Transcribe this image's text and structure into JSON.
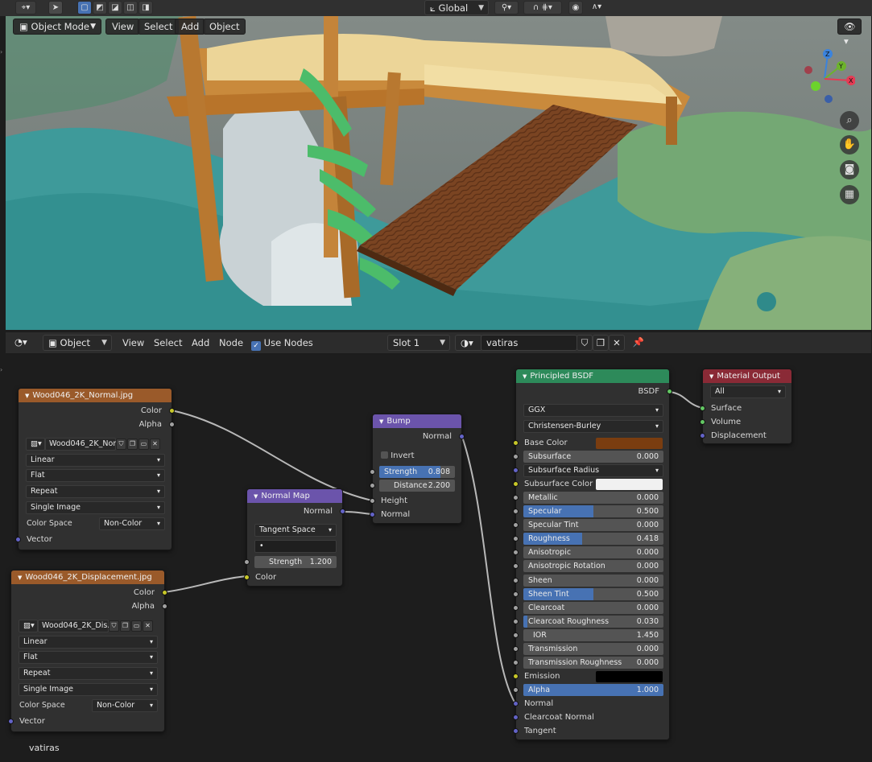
{
  "viewport": {
    "mode": "Object Mode",
    "menus": [
      "View",
      "Select",
      "Add",
      "Object"
    ],
    "orientation": "Global",
    "gizmo_axes": [
      "Z",
      "Y",
      "X"
    ]
  },
  "node_editor": {
    "editor_type": "Object",
    "menus": [
      "View",
      "Select",
      "Add",
      "Node"
    ],
    "use_nodes_label": "Use Nodes",
    "slot": "Slot 1",
    "material": "vatiras",
    "footer_material": "vatiras"
  },
  "nodes": {
    "normal_tex": {
      "title": "Wood046_2K_Normal.jpg",
      "out_color": "Color",
      "out_alpha": "Alpha",
      "image": "Wood046_2K_Nor...",
      "interpolation": "Linear",
      "projection": "Flat",
      "extension": "Repeat",
      "source": "Single Image",
      "color_space_label": "Color Space",
      "color_space": "Non-Color",
      "in_vector": "Vector"
    },
    "disp_tex": {
      "title": "Wood046_2K_Displacement.jpg",
      "out_color": "Color",
      "out_alpha": "Alpha",
      "image": "Wood046_2K_Dis...",
      "interpolation": "Linear",
      "projection": "Flat",
      "extension": "Repeat",
      "source": "Single Image",
      "color_space_label": "Color Space",
      "color_space": "Non-Color",
      "in_vector": "Vector"
    },
    "normal_map": {
      "title": "Normal Map",
      "out_normal": "Normal",
      "space": "Tangent Space",
      "uv": "•",
      "strength_label": "Strength",
      "strength": "1.200",
      "in_color": "Color"
    },
    "bump": {
      "title": "Bump",
      "out_normal": "Normal",
      "invert": "Invert",
      "strength_label": "Strength",
      "strength": "0.808",
      "strength_fraction": 0.808,
      "distance_label": "Distance",
      "distance": "2.200",
      "in_height": "Height",
      "in_normal": "Normal"
    },
    "bsdf": {
      "title": "Principled BSDF",
      "out": "BSDF",
      "distribution": "GGX",
      "subsurface_method": "Christensen-Burley",
      "inputs": [
        {
          "label": "Base Color",
          "type": "color",
          "color": "#7a3d10",
          "sock": "yel"
        },
        {
          "label": "Subsurface",
          "value": "0.000",
          "fraction": 0,
          "sock": "gry"
        },
        {
          "label": "Subsurface Radius",
          "type": "select",
          "sock": "blu"
        },
        {
          "label": "Subsurface Color",
          "type": "color",
          "color": "#f0f0f0",
          "sock": "yel"
        },
        {
          "label": "Metallic",
          "value": "0.000",
          "fraction": 0,
          "sock": "gry"
        },
        {
          "label": "Specular",
          "value": "0.500",
          "fraction": 0.5,
          "sock": "gry"
        },
        {
          "label": "Specular Tint",
          "value": "0.000",
          "fraction": 0,
          "sock": "gry"
        },
        {
          "label": "Roughness",
          "value": "0.418",
          "fraction": 0.418,
          "sock": "gry"
        },
        {
          "label": "Anisotropic",
          "value": "0.000",
          "fraction": 0,
          "sock": "gry"
        },
        {
          "label": "Anisotropic Rotation",
          "value": "0.000",
          "fraction": 0,
          "sock": "gry"
        },
        {
          "label": "Sheen",
          "value": "0.000",
          "fraction": 0,
          "sock": "gry"
        },
        {
          "label": "Sheen Tint",
          "value": "0.500",
          "fraction": 0.5,
          "sock": "gry"
        },
        {
          "label": "Clearcoat",
          "value": "0.000",
          "fraction": 0,
          "sock": "gry"
        },
        {
          "label": "Clearcoat Roughness",
          "value": "0.030",
          "fraction": 0.03,
          "sock": "gry"
        },
        {
          "label": "IOR",
          "value": "1.450",
          "fraction": 0,
          "sock": "gry",
          "indent": true
        },
        {
          "label": "Transmission",
          "value": "0.000",
          "fraction": 0,
          "sock": "gry"
        },
        {
          "label": "Transmission Roughness",
          "value": "0.000",
          "fraction": 0,
          "sock": "gry"
        },
        {
          "label": "Emission",
          "type": "color",
          "color": "#000000",
          "sock": "yel"
        },
        {
          "label": "Alpha",
          "value": "1.000",
          "fraction": 1,
          "sock": "gry"
        },
        {
          "label": "Normal",
          "type": "socket",
          "sock": "blu"
        },
        {
          "label": "Clearcoat Normal",
          "type": "socket",
          "sock": "blu"
        },
        {
          "label": "Tangent",
          "type": "socket",
          "sock": "blu"
        }
      ]
    },
    "output": {
      "title": "Material Output",
      "target": "All",
      "in_surface": "Surface",
      "in_volume": "Volume",
      "in_displacement": "Displacement"
    }
  },
  "colors": {
    "texture_header": "#9a5a2a",
    "vector_header": "#6b54ab",
    "shader_header": "#2d8a5a",
    "output_header": "#8a2a36",
    "accent": "#4772b3"
  }
}
